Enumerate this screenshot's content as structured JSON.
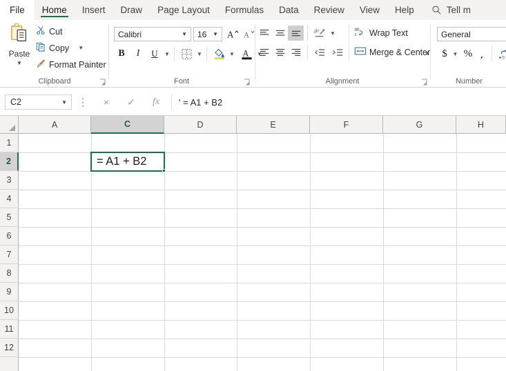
{
  "tabs": [
    {
      "label": "File",
      "active": false,
      "is_file": true
    },
    {
      "label": "Home",
      "active": true,
      "is_file": false
    },
    {
      "label": "Insert",
      "active": false,
      "is_file": false
    },
    {
      "label": "Draw",
      "active": false,
      "is_file": false
    },
    {
      "label": "Page Layout",
      "active": false,
      "is_file": false
    },
    {
      "label": "Formulas",
      "active": false,
      "is_file": false
    },
    {
      "label": "Data",
      "active": false,
      "is_file": false
    },
    {
      "label": "Review",
      "active": false,
      "is_file": false
    },
    {
      "label": "View",
      "active": false,
      "is_file": false
    },
    {
      "label": "Help",
      "active": false,
      "is_file": false
    }
  ],
  "tellme": {
    "label": "Tell m",
    "icon": "search-icon"
  },
  "ribbon": {
    "clipboard": {
      "group_label": "Clipboard",
      "paste_label": "Paste",
      "cut_label": "Cut",
      "copy_label": "Copy",
      "format_painter_label": "Format Painter"
    },
    "font": {
      "group_label": "Font",
      "font_name": "Calibri",
      "font_size": "16",
      "bold_label": "B",
      "italic_label": "I",
      "underline_label": "U",
      "grow_font_label": "A",
      "shrink_font_label": "A",
      "fill_color_label": "A",
      "font_color_label": "A"
    },
    "alignment": {
      "group_label": "Alignment",
      "wrap_text_label": "Wrap Text",
      "merge_center_label": "Merge & Center",
      "active_vertical_align": "bottom-align"
    },
    "number": {
      "group_label": "Number",
      "format": "General",
      "currency_label": "$",
      "percent_label": "%",
      "comma_label": "͵"
    }
  },
  "formula_bar": {
    "name_box_value": "C2",
    "cancel_label": "×",
    "enter_label": "✓",
    "function_label": "fx",
    "formula_value": "' = A1 + B2"
  },
  "grid": {
    "columns": [
      "A",
      "C",
      "D",
      "E",
      "F",
      "G",
      "H"
    ],
    "selected_column": "C",
    "rows": [
      "1",
      "2",
      "3",
      "4",
      "5",
      "6",
      "7",
      "8",
      "9",
      "10",
      "11",
      "12"
    ],
    "selected_row": "2",
    "selected_cell": "C2",
    "cells": [
      {
        "ref": "C2",
        "value": "= A1 + B2"
      }
    ]
  },
  "colors": {
    "accent_green": "#1b7245",
    "ribbon_bg": "#ffffff",
    "tabstrip_bg": "#f3f2f1",
    "header_bg": "#f3f2f1",
    "gridline": "#d9d9d9"
  }
}
